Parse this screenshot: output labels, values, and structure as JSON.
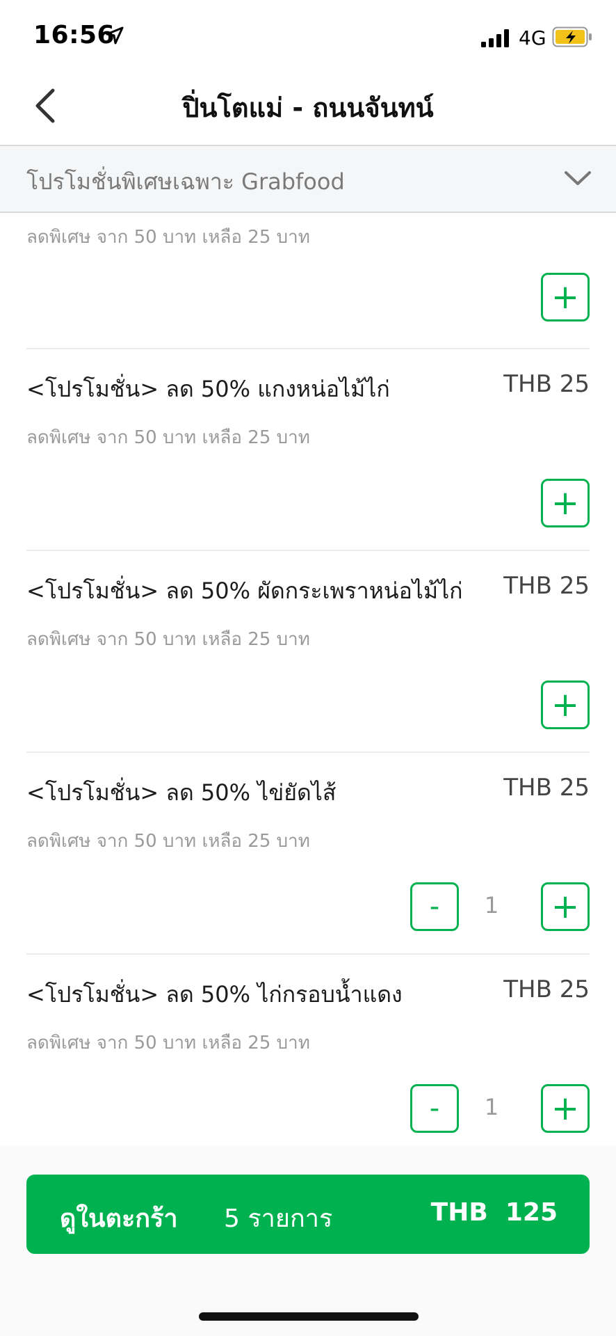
{
  "status_bar": {
    "time": "16:56",
    "network": "4G"
  },
  "nav": {
    "title": "ปิ่นโตแม่ - ถนนจันทน์"
  },
  "category": {
    "label": "โปรโมชั่นพิเศษเฉพาะ Grabfood"
  },
  "partial_item": {
    "description": "ลดพิเศษ จาก 50 บาท เหลือ 25 บาท"
  },
  "items": [
    {
      "name": "<โปรโมชั่น> ลด 50% แกงหน่อไม้ไก่",
      "price": "THB 25",
      "description": "ลดพิเศษ จาก 50 บาท เหลือ 25 บาท"
    },
    {
      "name": "<โปรโมชั่น> ลด 50% ผัดกระเพราหน่อไม้ไก่",
      "price": "THB 25",
      "description": "ลดพิเศษ จาก 50 บาท เหลือ 25 บาท"
    },
    {
      "name": "<โปรโมชั่น> ลด 50% ไข่ยัดไส้",
      "price": "THB 25",
      "description": "ลดพิเศษ จาก 50 บาท เหลือ 25 บาท",
      "quantity": "1"
    },
    {
      "name": "<โปรโมชั่น> ลด 50% ไก่กรอบน้ำแดง",
      "price": "THB 25",
      "description": "ลดพิเศษ จาก 50 บาท เหลือ 25 บาท",
      "quantity": "1"
    }
  ],
  "controls": {
    "plus": "+",
    "minus": "-"
  },
  "cart": {
    "label": "ดูในตะกร้า",
    "count": "5 รายการ",
    "total": "THB  125"
  },
  "colors": {
    "accent": "#00b14f",
    "battery": "#f2c21b"
  }
}
